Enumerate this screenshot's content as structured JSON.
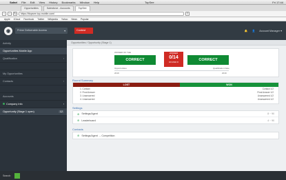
{
  "menubar": {
    "items": [
      "Safari",
      "File",
      "Edit",
      "View",
      "History",
      "Bookmarks",
      "Window",
      "Help"
    ],
    "center_title": "TopSee",
    "status": "Fri 17:44"
  },
  "tabs": [
    {
      "label": "Opportunities"
    },
    {
      "label": "Salesforce - Accounts"
    },
    {
      "label": "TopSee"
    }
  ],
  "url": {
    "value": "https://ttopsee.top-mobile.com/"
  },
  "bookmarks": [
    "Apple",
    "iCloud",
    "Facebook",
    "Twitter",
    "Wikipedia",
    "Yahoo",
    "News",
    "Popular"
  ],
  "header": {
    "selector_label": "Prime Deliverable Access",
    "selector_caret": "▾",
    "red_button": "Contest",
    "user_name": "Account Manager",
    "user_caret": "▾",
    "bell": "🔔",
    "person": "👤"
  },
  "sidebar": {
    "items": [
      {
        "label": "Activity",
        "badge": ""
      },
      {
        "label": "Opportunities Mobile App",
        "badge": ""
      },
      {
        "label": "Qualification",
        "badge": "›"
      },
      {
        "label": "",
        "badge": ""
      },
      {
        "label": "My Opportunities",
        "badge": ""
      },
      {
        "label": "Contacts",
        "badge": "›"
      },
      {
        "label": "",
        "badge": ""
      },
      {
        "label": "Accounts",
        "badge": ""
      },
      {
        "label": "Company Info",
        "badge": "›"
      },
      {
        "label": "Opportunity (Stage 1 open)",
        "badge": "12"
      }
    ]
  },
  "main": {
    "breadcrumb": "Opportunities / Opportunity (Stage 1)",
    "scoreboard": {
      "top_label": "WINNER OF THE",
      "left_team": "CORRECT",
      "right_team": "CORRECT",
      "score_top": "WINNER",
      "score_main": "0/14",
      "score_bottom": "ROUND 8",
      "left_caption": "Opportunities",
      "right_caption": "Qualification Date",
      "left_sub": "2019",
      "right_sub": "2019"
    },
    "lost_won": {
      "section_title": "Round Summary",
      "lost_label": "LOST",
      "won_label": "WON",
      "rows": [
        {
          "left": "1. Contact",
          "right": "Contact 1/2"
        },
        {
          "left": "2. Final Answer",
          "right": "Final Answer 1/2"
        },
        {
          "left": "3. Unanswered",
          "right": "Unanswered 1/2"
        },
        {
          "left": "4. Unanswered",
          "right": "Unanswered 1/2"
        }
      ]
    },
    "settings": {
      "title": "Settings",
      "rows": [
        {
          "label": "Settings/Agent",
          "right": "8 ·· 90"
        },
        {
          "label": "Leaderboard",
          "right": "4 ·· 90"
        }
      ]
    },
    "contacts": {
      "title": "Contacts",
      "rows": [
        {
          "label": "Settings/Agent  →  Competition",
          "right": ""
        }
      ]
    }
  },
  "bottombar": {
    "label": "Search"
  },
  "colors": {
    "header": "#323b43",
    "accent_red": "#cf2b24",
    "accent_green": "#0f8a33",
    "lost": "#8a1d12",
    "won": "#16923a"
  }
}
